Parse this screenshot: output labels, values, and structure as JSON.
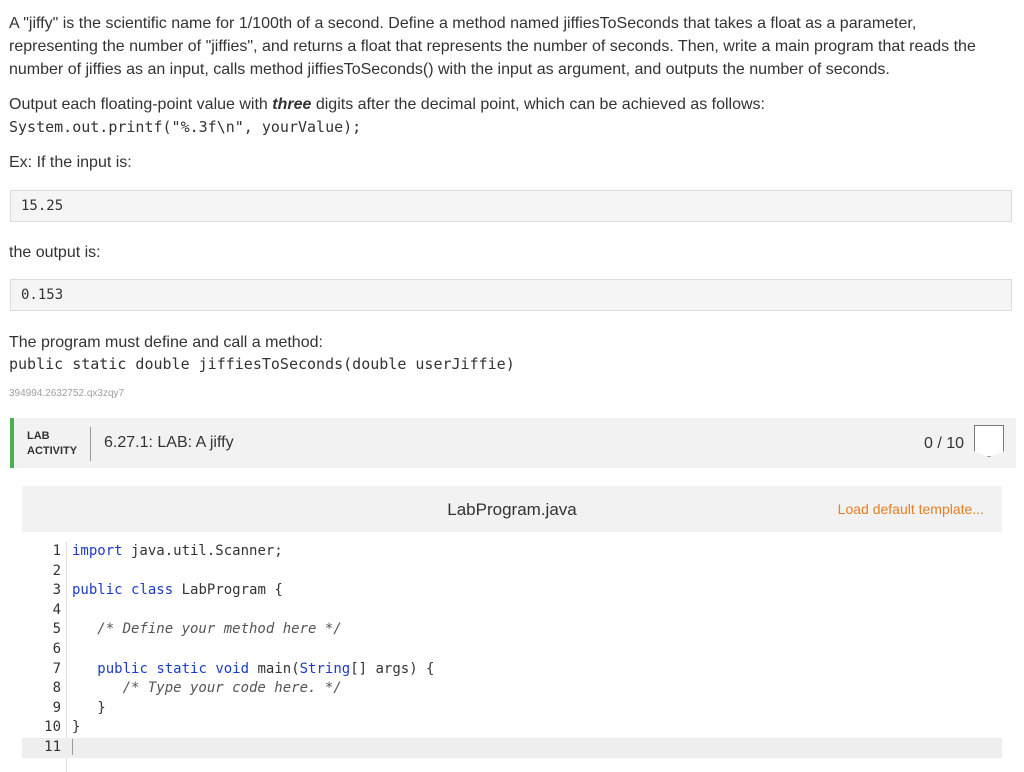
{
  "instructions": {
    "p1": "A \"jiffy\" is the scientific name for 1/100th of a second. Define a method named jiffiesToSeconds that takes a float as a parameter, representing the number of \"jiffies\", and returns a float that represents the number of seconds. Then, write a main program that reads the number of jiffies as an input, calls method jiffiesToSeconds() with the input as argument, and outputs the number of seconds.",
    "p2_a": "Output each floating-point value with ",
    "p2_em": "three",
    "p2_b": " digits after the decimal point, which can be achieved as follows:",
    "printf_line": "System.out.printf(\"%.3f\\n\", yourValue);",
    "ex_label": "Ex: If the input is:",
    "example_input": "15.25",
    "output_label": "the output is:",
    "example_output": "0.153",
    "must_define": "The program must define and call a method:",
    "signature": "public static double jiffiesToSeconds(double userJiffie)",
    "lab_id": "394994.2632752.qx3zqy7"
  },
  "lab": {
    "tag_line1": "LAB",
    "tag_line2": "ACTIVITY",
    "title": "6.27.1: LAB: A jiffy",
    "score": "0 / 10",
    "accent_color": "#4caf50"
  },
  "editor": {
    "file_name": "LabProgram.java",
    "load_template": "Load default template...",
    "lines": [
      {
        "n": "1",
        "code": ""
      },
      {
        "n": "2",
        "code": ""
      },
      {
        "n": "3",
        "code": ""
      },
      {
        "n": "4",
        "code": ""
      },
      {
        "n": "5",
        "code": ""
      },
      {
        "n": "6",
        "code": ""
      },
      {
        "n": "7",
        "code": ""
      },
      {
        "n": "8",
        "code": ""
      },
      {
        "n": "9",
        "code": ""
      },
      {
        "n": "10",
        "code": ""
      },
      {
        "n": "11",
        "code": ""
      }
    ],
    "code_tokens": {
      "l1_kw": "import",
      "l1_rest": " java.util.Scanner;",
      "l3_kw1": "public",
      "l3_kw2": "class",
      "l3_rest": " LabProgram {",
      "l5": "   /* Define your method here */",
      "l7_kw1": "public",
      "l7_kw2": "static",
      "l7_kw3": "void",
      "l7_rest_a": " main(",
      "l7_type": "String",
      "l7_rest_b": "[] args) {",
      "l8": "      /* Type your code here. */",
      "l9": "   }",
      "l10": "}"
    }
  }
}
